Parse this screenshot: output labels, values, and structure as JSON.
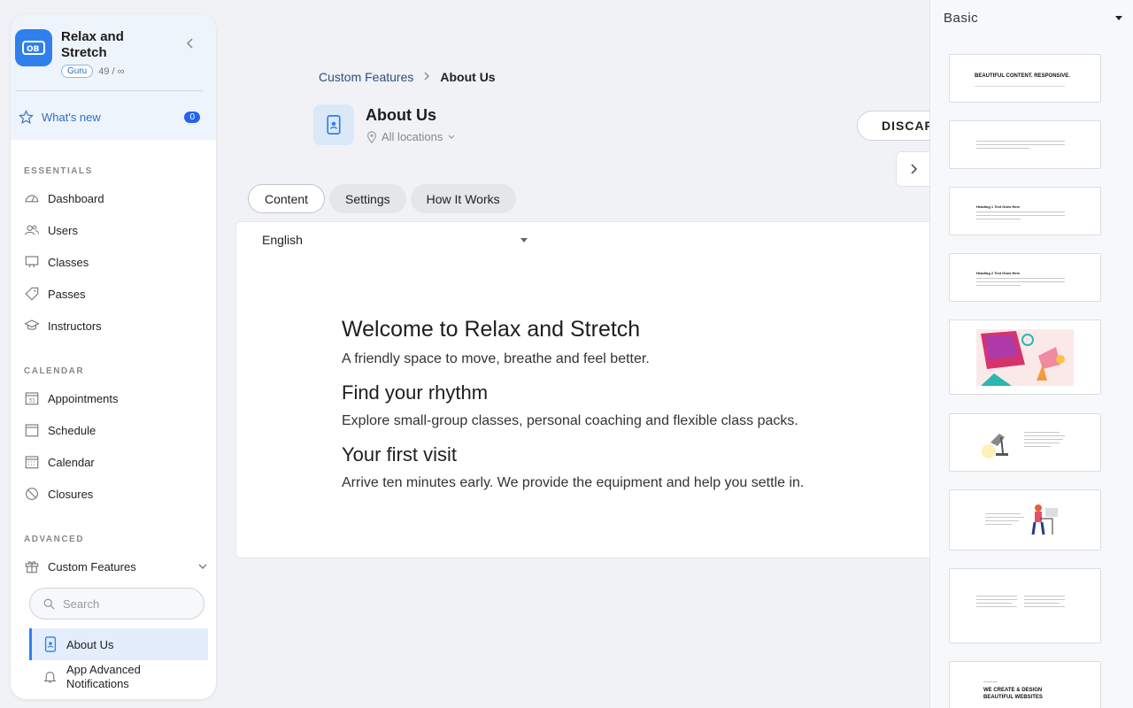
{
  "app": {
    "name": "Relax and Stretch",
    "plan": "Guru",
    "plan_usage": "49 / ∞",
    "accent": "#2f80ed"
  },
  "whats_new": {
    "label": "What's new",
    "count": "0"
  },
  "sidebar": {
    "essentials_label": "ESSENTIALS",
    "essentials": [
      {
        "label": "Dashboard",
        "icon": "dashboard-icon"
      },
      {
        "label": "Users",
        "icon": "users-icon"
      },
      {
        "label": "Classes",
        "icon": "classes-icon"
      },
      {
        "label": "Passes",
        "icon": "tag-icon"
      },
      {
        "label": "Instructors",
        "icon": "graduation-cap-icon"
      }
    ],
    "calendar_label": "CALENDAR",
    "calendar": [
      {
        "label": "Appointments",
        "icon": "calendar-31-icon"
      },
      {
        "label": "Schedule",
        "icon": "schedule-icon"
      },
      {
        "label": "Calendar",
        "icon": "calendar-grid-icon"
      },
      {
        "label": "Closures",
        "icon": "prohibited-icon"
      }
    ],
    "advanced_label": "ADVANCED",
    "custom_features": {
      "label": "Custom Features",
      "icon": "gift-icon"
    },
    "search_placeholder": "Search",
    "sub_items": [
      {
        "label": "About Us",
        "icon": "phone-icon",
        "active": true
      },
      {
        "label": "App Advanced Notifications",
        "icon": "bell-icon",
        "active": false
      }
    ]
  },
  "breadcrumb": {
    "parent": "Custom Features",
    "separator": "›",
    "current": "About Us"
  },
  "page": {
    "title": "About Us",
    "locations": "All locations",
    "discard_label": "DISCARD"
  },
  "tabs": [
    "Content",
    "Settings",
    "How It Works"
  ],
  "language": "English",
  "content": {
    "h1": "Welcome to Relax and Stretch",
    "p1": "A friendly space to move, breathe and feel better.",
    "h2a": "Find your rhythm",
    "p2": "Explore small-group classes, personal coaching and flexible class packs.",
    "h2b": "Your first visit",
    "p3": "Arrive ten minutes early. We provide the equipment and help you settle in."
  },
  "templates": {
    "category": "Basic",
    "items": [
      {
        "title": "BEAUTIFUL CONTENT. RESPONSIVE."
      },
      {
        "title": ""
      },
      {
        "title": "Heading 1 Text Goes Here"
      },
      {
        "title": "Heading 2 Text Goes Here"
      },
      {
        "title": ""
      },
      {
        "title": ""
      },
      {
        "title": ""
      },
      {
        "title": ""
      },
      {
        "title": "WE CREATE & DESIGN BEAUTIFUL WEBSITES"
      }
    ]
  }
}
